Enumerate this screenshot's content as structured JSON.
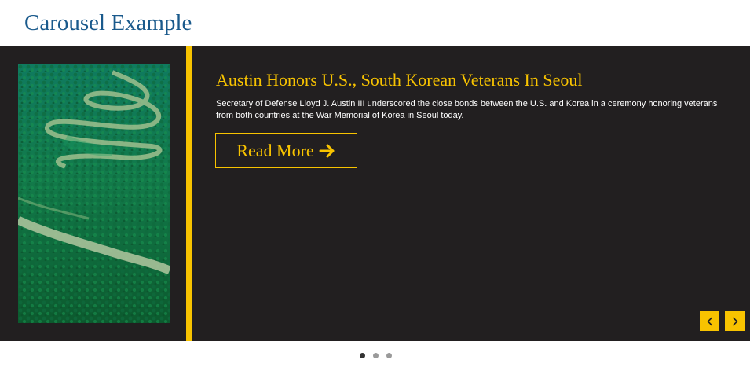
{
  "page": {
    "title": "Carousel Example"
  },
  "carousel": {
    "slide": {
      "image_icon": "river-aerial-photo",
      "headline": "Austin Honors U.S., South Korean Veterans In Seoul",
      "body": "Secretary of Defense Lloyd J. Austin III underscored the close bonds between the U.S. and Korea in a ceremony honoring veterans from both countries at the War Memorial of Korea in Seoul today.",
      "cta_label": "Read More",
      "cta_icon": "arrow-right-icon"
    },
    "controls": {
      "prev_icon": "chevron-left-icon",
      "next_icon": "chevron-right-icon"
    },
    "indicators": {
      "count": 3,
      "active_index": 0
    }
  },
  "colors": {
    "title": "#1a5a8c",
    "carousel_background": "#221f20",
    "accent": "#f8c300",
    "body_text": "#ffffff",
    "dot_active": "#333333",
    "dot_inactive": "#9a9a9a"
  }
}
